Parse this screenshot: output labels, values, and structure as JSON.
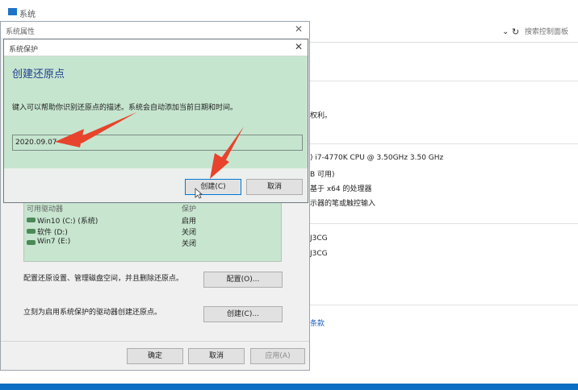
{
  "background_window": {
    "title": "系统",
    "search_placeholder": "搜索控制面板",
    "lines": {
      "rights": "权利。",
      "cpu": ") i7-4770K CPU @ 3.50GHz   3.50 GHz",
      "ram": "B 可用)",
      "system_type": "基于 x64 的处理器",
      "pen": "示器的笔或触控输入",
      "name1": "J3CG",
      "name2": "J3CG",
      "link": "条款"
    }
  },
  "properties_dialog": {
    "title": "系统属性",
    "list_header_name": "可用驱动器",
    "list_header_state": "保护",
    "drives": [
      {
        "name": "Win10 (C:) (系统)",
        "state": "启用"
      },
      {
        "name": "软件 (D:)",
        "state": "关闭"
      },
      {
        "name": "Win7 (E:)",
        "state": "关闭"
      }
    ],
    "configure_desc": "配置还原设置、管理磁盘空间，并且删除还原点。",
    "configure_button": "配置(O)...",
    "create_desc": "立刻为启用系统保护的驱动器创建还原点。",
    "create_button": "创建(C)...",
    "ok_button": "确定",
    "cancel_button": "取消",
    "apply_button": "应用(A)"
  },
  "protection_dialog": {
    "title": "系统保护",
    "heading": "创建还原点",
    "instructions": "键入可以帮助你识别还原点的描述。系统会自动添加当前日期和时间。",
    "description_value": "2020.09.07",
    "create_button": "创建(C)",
    "cancel_button": "取消"
  },
  "colors": {
    "annotation_arrow": "#e8432c",
    "heading": "#1f3f8f",
    "highlight": "#c6e5cf"
  }
}
